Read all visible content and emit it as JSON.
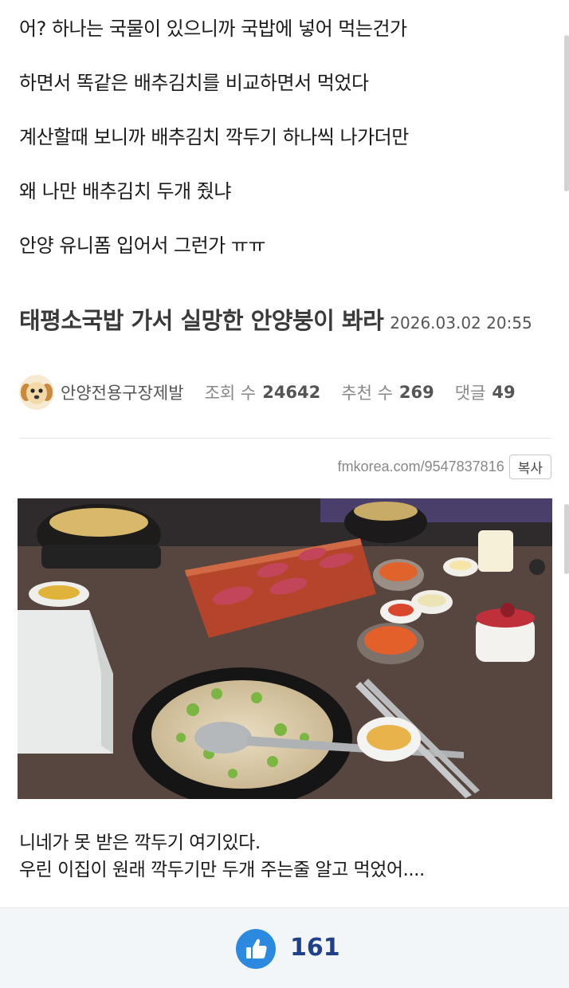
{
  "previous_post": {
    "lines": [
      "어? 하나는 국물이 있으니까 국밥에 넣어 먹는건가",
      "하면서 똑같은 배추김치를 비교하면서 먹었다",
      "계산할때 보니까 배추김치 깍두기 하나씩 나가더만",
      "왜 나만 배추김치 두개 줬냐",
      "안양 유니폼 입어서 그런가 ㅠㅠ"
    ]
  },
  "post": {
    "title": "태평소국밥 가서 실망한 안양붕이 봐라",
    "date": "2026.03.02 20:55",
    "author": "안양전용구장제발",
    "views_label": "조회 수",
    "views": "24642",
    "recommend_label": "추천 수",
    "recommend": "269",
    "comments_label": "댓글",
    "comments": "49",
    "url": "fmkorea.com/9547837816",
    "copy_label": "복사",
    "body_lines": [
      "니네가 못 받은 깍두기 여기있다.",
      "우린 이집이 원래 깍두기만 두개 주는줄 알고 먹었어...."
    ]
  },
  "like_bar": {
    "count": "161",
    "icon": "thumbs-up-icon",
    "accent": "#2b8ae0"
  }
}
